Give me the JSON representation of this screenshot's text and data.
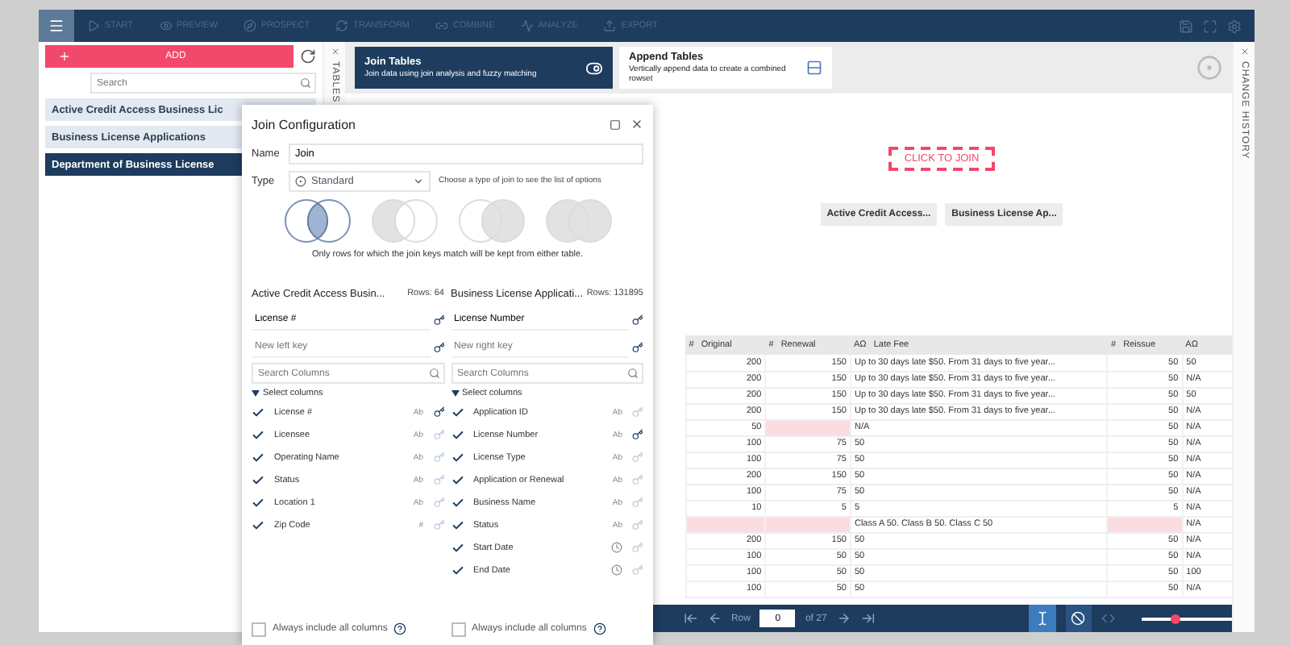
{
  "nav": {
    "items": [
      "START",
      "PREVIEW",
      "PROSPECT",
      "TRANSFORM",
      "COMBINE",
      "ANALYZE",
      "EXPORT"
    ]
  },
  "sidebar": {
    "add_label": "ADD",
    "search_placeholder": "Search",
    "tab_label": "TABLES",
    "tables": [
      {
        "name": "Active Credit Access Business Lic",
        "selected": false
      },
      {
        "name": "Business License Applications",
        "selected": false
      },
      {
        "name": "Department of Business License",
        "selected": true
      }
    ]
  },
  "modes": [
    {
      "kind": "join",
      "title": "Join Tables",
      "subtitle": "Join data using join analysis and fuzzy matching",
      "selected": true
    },
    {
      "kind": "append",
      "title": "Append Tables",
      "subtitle": "Vertically append data to create a combined rowset",
      "selected": false
    }
  ],
  "canvas": {
    "drop_label": "CLICK TO JOIN",
    "chips": [
      "Active Credit Access...",
      "Business License Ap..."
    ]
  },
  "dialog": {
    "title": "Join Configuration",
    "name_label": "Name",
    "name_value": "Join",
    "type_label": "Type",
    "type_value": "Standard",
    "type_hint": "Choose a type of join to see the list of options",
    "join_types": [
      {
        "kind": "inner",
        "selected": true
      },
      {
        "kind": "left",
        "selected": false
      },
      {
        "kind": "right",
        "selected": false
      },
      {
        "kind": "outer",
        "selected": false
      }
    ],
    "caption": "Only rows for which the join keys match will be kept from either table.",
    "sides": [
      {
        "table": "Active Credit Access Busin...",
        "rows": "Rows: 64",
        "key": "License #",
        "new_key_placeholder": "New left key",
        "search_placeholder": "Search Columns",
        "select_label": "Select columns",
        "expanded": true,
        "always_label": "Always include all columns",
        "always_checked": false,
        "columns": [
          {
            "name": "License #",
            "checked": true,
            "kind": "text",
            "badge": "Ab",
            "key": true
          },
          {
            "name": "Licensee",
            "checked": true,
            "kind": "text",
            "badge": "Ab",
            "key": false
          },
          {
            "name": "Operating Name",
            "checked": true,
            "kind": "text",
            "badge": "Ab",
            "key": false
          },
          {
            "name": "Status",
            "checked": true,
            "kind": "text",
            "badge": "Ab",
            "key": false
          },
          {
            "name": "Location 1",
            "checked": true,
            "kind": "text",
            "badge": "Ab",
            "key": false
          },
          {
            "name": "Zip Code",
            "checked": true,
            "kind": "number",
            "badge": "#",
            "key": false
          }
        ]
      },
      {
        "table": "Business License Applicati...",
        "rows": "Rows: 131895",
        "key": "License Number",
        "new_key_placeholder": "New right key",
        "search_placeholder": "Search Columns",
        "select_label": "Select columns",
        "expanded": true,
        "always_label": "Always include all columns",
        "always_checked": false,
        "columns": [
          {
            "name": "Application ID",
            "checked": true,
            "kind": "text",
            "badge": "Ab",
            "key": false
          },
          {
            "name": "License Number",
            "checked": true,
            "kind": "text",
            "badge": "Ab",
            "key": true
          },
          {
            "name": "License Type",
            "checked": true,
            "kind": "text",
            "badge": "Ab",
            "key": false
          },
          {
            "name": "Application or Renewal",
            "checked": true,
            "kind": "text",
            "badge": "Ab",
            "key": false
          },
          {
            "name": "Business Name",
            "checked": true,
            "kind": "text",
            "badge": "Ab",
            "key": false
          },
          {
            "name": "Status",
            "checked": true,
            "kind": "text",
            "badge": "Ab",
            "key": false
          },
          {
            "name": "Start Date",
            "checked": true,
            "kind": "date",
            "key": false
          },
          {
            "name": "End Date",
            "checked": true,
            "kind": "date",
            "key": false
          }
        ]
      }
    ]
  },
  "table": {
    "columns": [
      {
        "type": "#",
        "label": "Original",
        "kind": "number"
      },
      {
        "type": "#",
        "label": "Renewal",
        "kind": "number"
      },
      {
        "type": "AΩ",
        "label": "Late Fee",
        "kind": "text"
      },
      {
        "type": "#",
        "label": "Reissue",
        "kind": "number"
      },
      {
        "type": "AΩ",
        "kind": "text"
      }
    ],
    "rows": [
      [
        "200",
        "150",
        "Up to 30 days late $50. From 31 days to five year...",
        "50",
        "50"
      ],
      [
        "200",
        "150",
        "Up to 30 days late $50. From 31 days to five year...",
        "50",
        "N/A"
      ],
      [
        "200",
        "150",
        "Up to 30 days late $50. From 31 days to five year...",
        "50",
        "50"
      ],
      [
        "200",
        "150",
        "Up to 30 days late $50. From 31 days to five year...",
        "50",
        "N/A"
      ],
      [
        "50",
        null,
        "N/A",
        "50",
        "N/A"
      ],
      [
        "100",
        "75",
        "50",
        "50",
        "N/A"
      ],
      [
        "100",
        "75",
        "50",
        "50",
        "N/A"
      ],
      [
        "200",
        "150",
        "50",
        "50",
        "N/A"
      ],
      [
        "100",
        "75",
        "50",
        "50",
        "N/A"
      ],
      [
        "10",
        "5",
        "5",
        "5",
        "N/A"
      ],
      [
        null,
        null,
        "Class A 50. Class B 50. Class C 50",
        null,
        "N/A"
      ],
      [
        "200",
        "150",
        "50",
        "50",
        "N/A"
      ],
      [
        "100",
        "50",
        "50",
        "50",
        "N/A"
      ],
      [
        "100",
        "50",
        "50",
        "50",
        "100"
      ],
      [
        "100",
        "50",
        "50",
        "50",
        "N/A"
      ]
    ]
  },
  "history_tab": "CHANGE HISTORY",
  "pager": {
    "row_label": "Row",
    "row_value": "0",
    "of_label": "of 27",
    "wrap_on": true,
    "links_on": false,
    "zoom": {
      "level": 0.37
    }
  }
}
